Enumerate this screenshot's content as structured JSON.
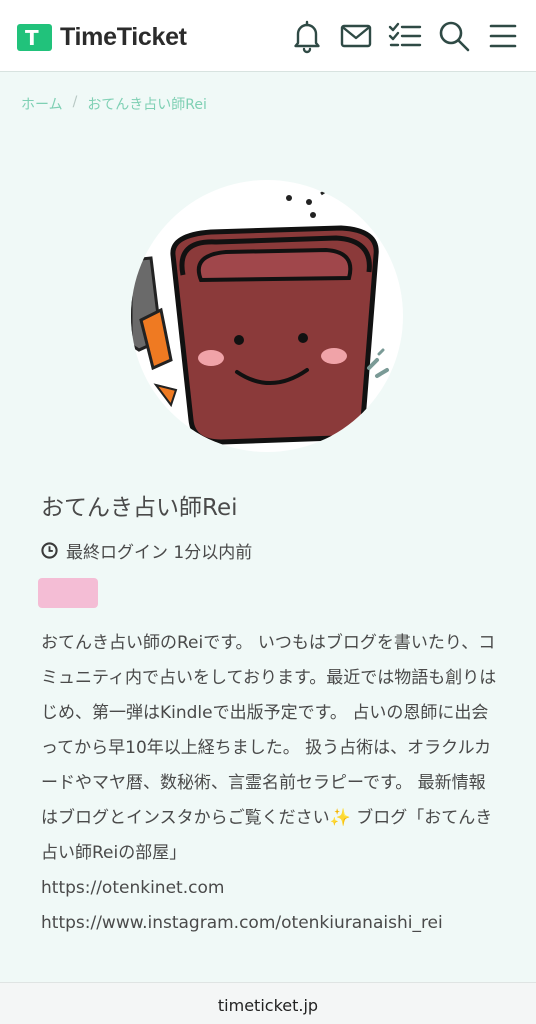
{
  "header": {
    "logo_text": "TimeTicket",
    "logo_letter": "T",
    "icons": [
      "bell-icon",
      "mail-icon",
      "checklist-icon",
      "search-icon",
      "menu-icon"
    ]
  },
  "breadcrumb": {
    "home": "ホーム",
    "separator": "/",
    "current": "おてんき占い師Rei"
  },
  "profile": {
    "name": "おてんき占い師Rei",
    "last_login": "最終ログイン 1分以内前",
    "bio": "おてんき占い師のReiです。 いつもはブログを書いたり、コミュニティ内で占いをしております。最近では物語も創りはじめ、第一弾はKindleで出版予定です。 占いの恩師に出会ってから早10年以上経ちました。 扱う占術は、オラクルカードやマヤ暦、数秘術、言霊名前セラピーです。 最新情報はブログとインスタからご覧ください✨ ブログ「おてんき占い師Reiの部屋」",
    "link1": "https://otenkinet.com",
    "link2": "https://www.instagram.com/otenkiuranaishi_rei"
  },
  "footer": {
    "domain": "timeticket.jp"
  },
  "colors": {
    "brand": "#21c27b",
    "background": "#f0f9f7",
    "breadcrumb": "#7fd0b4",
    "pot": "#8b3a3a"
  }
}
